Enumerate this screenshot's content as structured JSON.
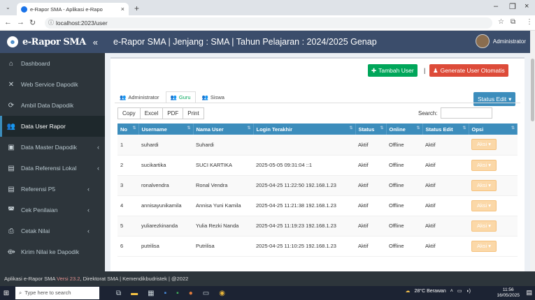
{
  "browser": {
    "tab_title": "e-Rapor SMA - Aplikasi e-Rapo",
    "url": "localhost:2023/user"
  },
  "brand": {
    "name": "e-Rapor SMA",
    "collapse": "«"
  },
  "topbar": {
    "title": "e-Rapor SMA | Jenjang : SMA | Tahun Pelajaran : 2024/2025 Genap",
    "user": "Administrator"
  },
  "sidebar": {
    "items": [
      {
        "label": "Dashboard",
        "icon": "home-icon"
      },
      {
        "label": "Web Service Dapodik",
        "icon": "tools-icon"
      },
      {
        "label": "Ambil Data Dapodik",
        "icon": "sync-icon"
      },
      {
        "label": "Data User Rapor",
        "icon": "users-icon"
      },
      {
        "label": "Data Master Dapodik",
        "icon": "database-icon"
      },
      {
        "label": "Data Referensi Lokal",
        "icon": "folder-icon"
      },
      {
        "label": "Referensi P5",
        "icon": "folder-icon"
      },
      {
        "label": "Cek Penilaian",
        "icon": "car-icon"
      },
      {
        "label": "Cetak Nilai",
        "icon": "print-icon"
      },
      {
        "label": "Kirim Nilai ke Dapodik",
        "icon": "send-icon"
      }
    ]
  },
  "actions": {
    "tambah_user": "Tambah User",
    "separator": "|",
    "generate": "Generate User Otomatis",
    "status_edit": "Status Edit"
  },
  "tabs": [
    "Administrator",
    "Guru",
    "Siswa"
  ],
  "dt_buttons": [
    "Copy",
    "Excel",
    "PDF",
    "Print"
  ],
  "search_label": "Search:",
  "table": {
    "headers": [
      "No",
      "Username",
      "Nama User",
      "Login Terakhir",
      "Status",
      "Online",
      "Status Edit",
      "Opsi"
    ],
    "rows": [
      {
        "no": "1",
        "username": "suhardi",
        "nama": "Suhardi",
        "login": "",
        "status": "Aktif",
        "online": "Offline",
        "status_edit": "Aktif",
        "opsi": "Aksi"
      },
      {
        "no": "2",
        "username": "sucikartika",
        "nama": "SUCI KARTIKA",
        "login": "2025-05-05 09:31:04 ::1",
        "status": "Aktif",
        "online": "Offline",
        "status_edit": "Aktif",
        "opsi": "Aksi"
      },
      {
        "no": "3",
        "username": "ronalvendra",
        "nama": "Ronal Vendra",
        "login": "2025-04-25 11:22:50 192.168.1.23",
        "status": "Aktif",
        "online": "Offline",
        "status_edit": "Aktif",
        "opsi": "Aksi"
      },
      {
        "no": "4",
        "username": "annisayunikamila",
        "nama": "Annisa Yuni Kamila",
        "login": "2025-04-25 11:21:38 192.168.1.23",
        "status": "Aktif",
        "online": "Offline",
        "status_edit": "Aktif",
        "opsi": "Aksi"
      },
      {
        "no": "5",
        "username": "yuliarezkinanda",
        "nama": "Yulia Rezki Nanda",
        "login": "2025-04-25 11:19:23 192.168.1.23",
        "status": "Aktif",
        "online": "Offline",
        "status_edit": "Aktif",
        "opsi": "Aksi"
      },
      {
        "no": "6",
        "username": "putrilisa",
        "nama": "Putrilisa",
        "login": "2025-04-25 11:10:25 192.168.1.23",
        "status": "Aktif",
        "online": "Offline",
        "status_edit": "Aktif",
        "opsi": "Aksi"
      }
    ]
  },
  "footer": {
    "prefix": "Aplikasi e-Rapor SMA",
    "version": "Versi 23.2",
    "suffix": ", Direktorat SMA | Kemendikbudristek | @2022"
  },
  "taskbar": {
    "search_placeholder": "Type here to search",
    "weather": "28°C Berawan",
    "time": "11:56",
    "date": "16/05/2025"
  },
  "colors": {
    "header": "#3b4d6b",
    "sidebar": "#2d353b",
    "table_header": "#3c8dbc",
    "green": "#00a65a",
    "red": "#dd4b39"
  }
}
